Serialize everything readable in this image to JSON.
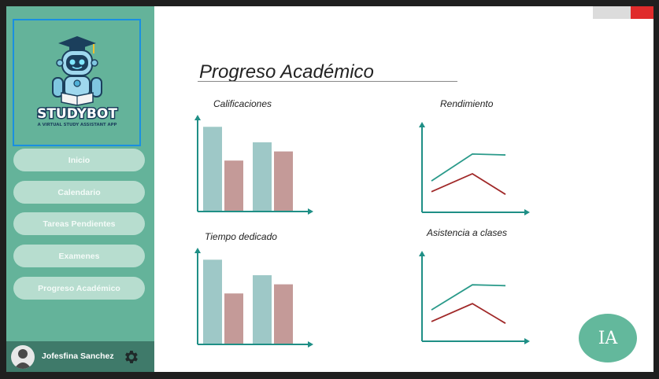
{
  "logo": {
    "brand": "STUDYBOT",
    "tagline": "A VIRTUAL STUDY ASSISTANT APP"
  },
  "sidebar": {
    "items": [
      {
        "label": "Inicio"
      },
      {
        "label": "Calendario"
      },
      {
        "label": "Tareas Pendientes"
      },
      {
        "label": "Examenes"
      },
      {
        "label": "Progreso Académico"
      }
    ]
  },
  "user": {
    "name": "Jofesfina Sanchez",
    "icons": [
      "avatar-icon",
      "gear-icon"
    ]
  },
  "main": {
    "title": "Progreso Académico"
  },
  "charts": [
    {
      "title": "Calificaciones",
      "type": "bar",
      "values": [
        0.92,
        0.55,
        0.75,
        0.65
      ],
      "colors": [
        "#9ec8c7",
        "#c49a98"
      ]
    },
    {
      "title": "Rendimiento",
      "type": "line",
      "series": [
        [
          0.35,
          0.65,
          0.64
        ],
        [
          0.23,
          0.43,
          0.2
        ]
      ],
      "colors": [
        "#2a9a8a",
        "#a02828"
      ]
    },
    {
      "title": "Tiempo dedicado",
      "type": "bar",
      "values": [
        0.92,
        0.55,
        0.75,
        0.65
      ],
      "colors": [
        "#9ec8c7",
        "#c49a98"
      ]
    },
    {
      "title": "Asistencia a clases",
      "type": "line",
      "series": [
        [
          0.35,
          0.63,
          0.62
        ],
        [
          0.22,
          0.42,
          0.2
        ]
      ],
      "colors": [
        "#2a9a8a",
        "#a02828"
      ]
    }
  ],
  "ia_button": {
    "label": "IA"
  },
  "colors": {
    "sidebar": "#64b39a",
    "nav_item": "#b7ddcf",
    "user_bar": "#3f7a6a",
    "axis": "#1f8f86",
    "close": "#e02b2b"
  }
}
